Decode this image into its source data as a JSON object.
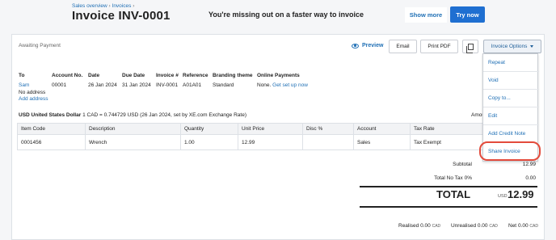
{
  "header": {
    "breadcrumb_1": "Sales overview",
    "breadcrumb_2": "Invoices",
    "breadcrumb_sep": "›",
    "title": "Invoice INV-0001",
    "promo_text": "You're missing out on a faster way to invoice",
    "show_more": "Show more",
    "try_now": "Try now"
  },
  "toolbar": {
    "status": "Awaiting Payment",
    "preview": "Preview",
    "email": "Email",
    "print_pdf": "Print PDF",
    "options": "Invoice Options"
  },
  "details": {
    "headers": [
      "To",
      "Account No.",
      "Date",
      "Due Date",
      "Invoice #",
      "Reference",
      "Branding theme",
      "Online Payments"
    ],
    "to_name": "Sam",
    "to_address": "No address",
    "add_address": "Add address",
    "account_no": "00001",
    "date": "26 Jan 2024",
    "due_date": "31 Jan 2024",
    "invoice_no": "INV-0001",
    "reference": "A01A01",
    "branding": "Standard",
    "online_none": "None.",
    "online_link": "Get set up now"
  },
  "currency": {
    "label": "USD United States Dollar",
    "rate": " 1 CAD = 0.744729 USD (26 Jan 2024, set by XE.com Exchange Rate)",
    "amounts_cut": "Amou"
  },
  "table": {
    "columns": [
      "Item Code",
      "Description",
      "Quantity",
      "Unit Price",
      "Disc %",
      "Account",
      "Tax Rate"
    ],
    "rows": [
      {
        "item_code": "0001456",
        "description": "Wrench",
        "quantity": "1.00",
        "unit_price": "12.99",
        "disc": "",
        "account": "Sales",
        "tax_rate": "Tax Exempt"
      }
    ]
  },
  "totals": {
    "subtotal_label": "Subtotal",
    "subtotal_value": "12.99",
    "tax_label": "Total No Tax 0%",
    "tax_value": "0.00",
    "total_label": "TOTAL",
    "total_currency": "USD",
    "total_value": "12.99"
  },
  "footer": {
    "realised_label": "Realised",
    "realised_value": "0.00",
    "unrealised_label": "Unrealised",
    "unrealised_value": "0.00",
    "net_label": "Net",
    "net_value": "0.00",
    "cad": "CAD"
  },
  "menu": {
    "items": [
      "Repeat",
      "Void",
      "Copy to...",
      "Edit",
      "Add Credit Note",
      "Share Invoice"
    ]
  },
  "colors": {
    "accent": "#1f6fd1",
    "link": "#1f6fb5",
    "highlight": "#e34b3c"
  }
}
